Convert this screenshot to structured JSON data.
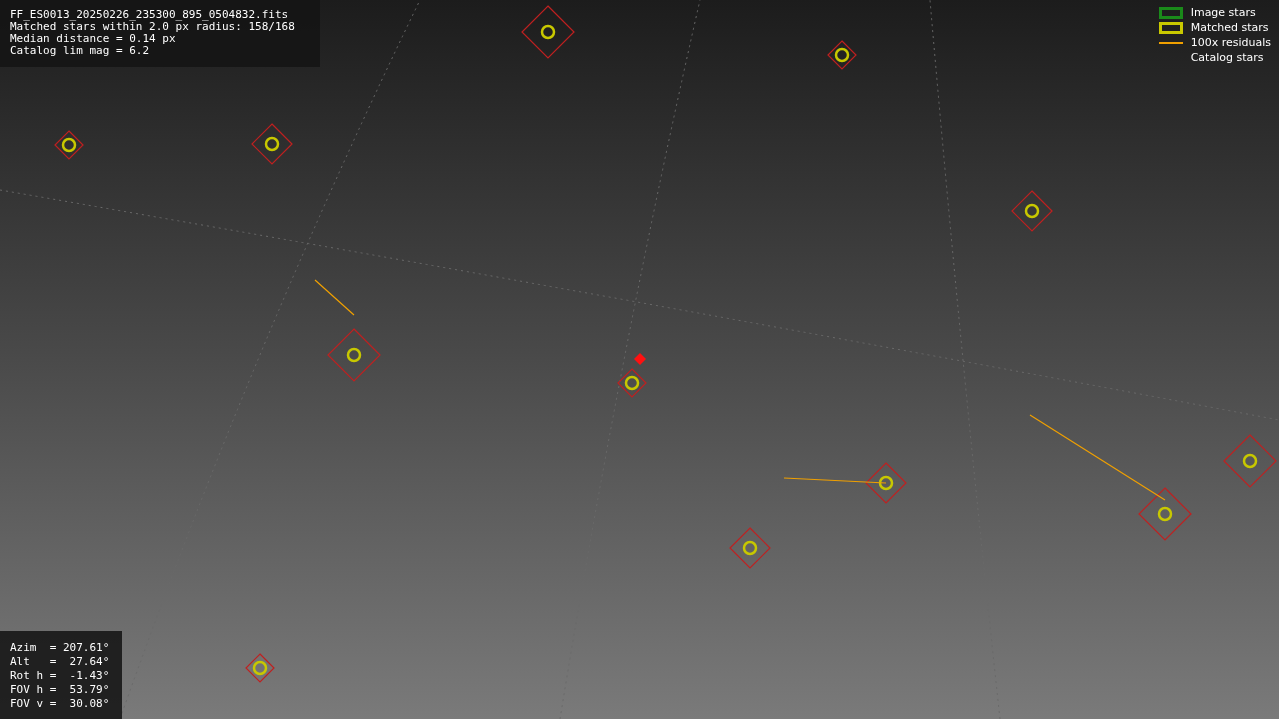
{
  "info": {
    "lines": [
      "FF_ES0013_20250226_235300_895_0504832.fits",
      "Matched stars within 2.0 px radius: 158/168",
      "Median distance = 0.14 px",
      "Catalog lim mag = 6.2"
    ]
  },
  "legend": [
    {
      "label": "Image stars",
      "color": "#1a8a1a"
    },
    {
      "kind": "matched",
      "label": "Matched stars",
      "color": "#c8c800"
    },
    {
      "kind": "residual",
      "label": "100x residuals",
      "color": "#f0a000"
    },
    {
      "kind": "catalog",
      "label": "Catalog stars"
    }
  ],
  "pointing": {
    "lines": [
      "Azim  = 207.61°",
      "Alt   =  27.64°",
      "Rot h =  -1.43°",
      "FOV h =  53.79°",
      "FOV v =  30.08°"
    ]
  }
}
